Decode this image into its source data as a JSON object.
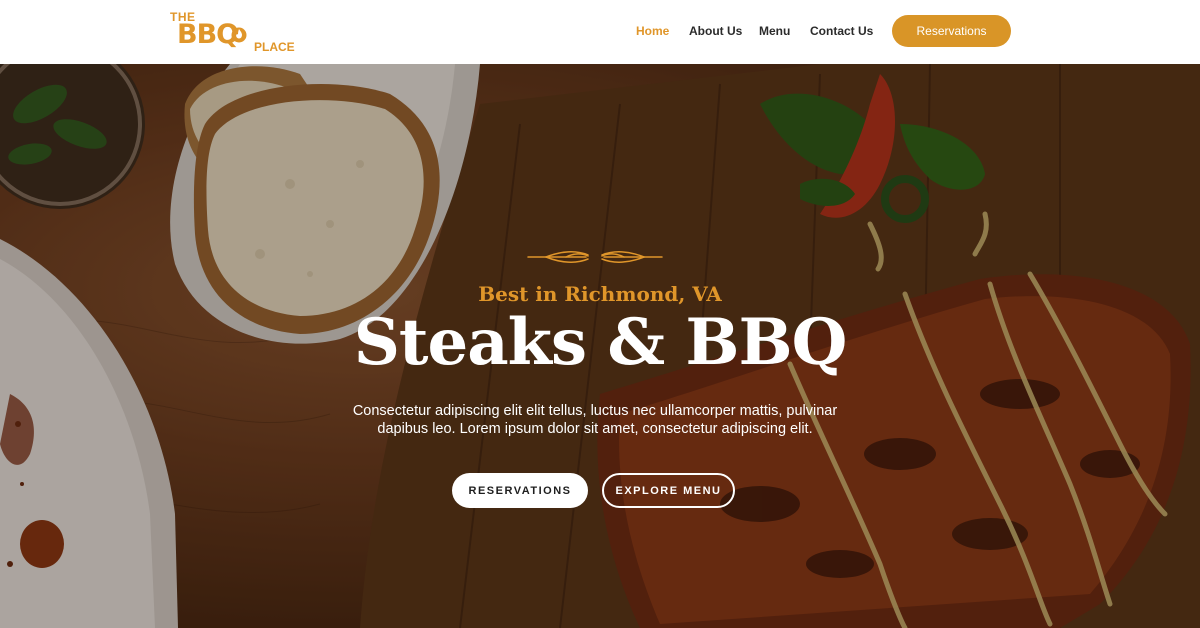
{
  "brand": {
    "logo_the": "THE",
    "logo_bbq": "BBQ",
    "logo_place": "PLACE",
    "accent_color": "#d99527"
  },
  "nav": {
    "items": [
      {
        "label": "Home",
        "active": true
      },
      {
        "label": "About Us",
        "active": false
      },
      {
        "label": "Menu",
        "active": false
      },
      {
        "label": "Contact Us",
        "active": false
      }
    ],
    "cta_label": "Reservations"
  },
  "hero": {
    "kicker": "Best in Richmond, VA",
    "title": "Steaks & BBQ",
    "description": "Consectetur adipiscing elit elit tellus, luctus nec ullamcorper mattis, pulvinar dapibus leo. Lorem ipsum dolor sit amet, consectetur adipiscing elit.",
    "primary_button": "RESERVATIONS",
    "secondary_button": "EXPLORE MENU",
    "ornament_icon": "decorative-divider-icon"
  }
}
